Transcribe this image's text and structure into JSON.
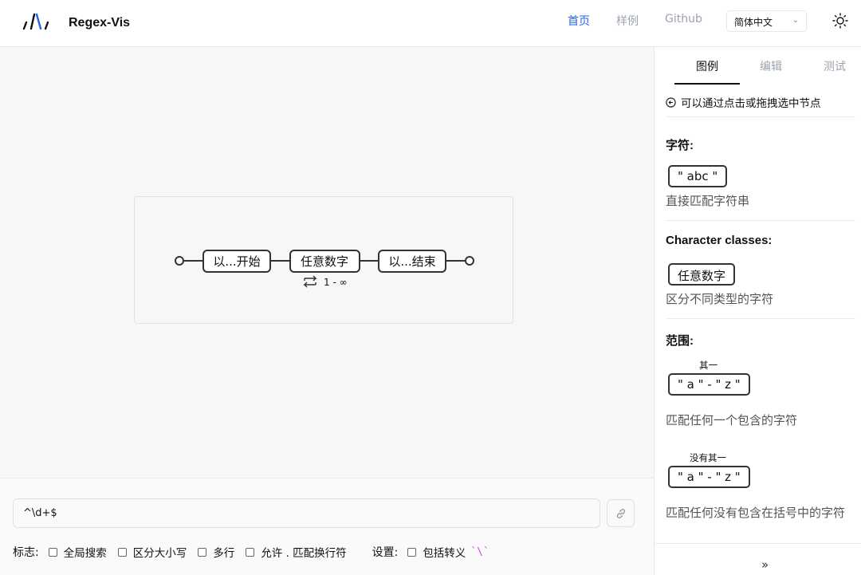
{
  "header": {
    "brand": "Regex-Vis",
    "nav": [
      "首页",
      "样例",
      "Github"
    ],
    "language": "简体中文"
  },
  "graph": {
    "nodes": [
      "以...开始",
      "任意数字",
      "以...结束"
    ],
    "quantifier": "1 - ∞"
  },
  "input": {
    "value": "^\\d+$"
  },
  "flags": {
    "label": "标志:",
    "items": [
      "全局搜索",
      "区分大小写",
      "多行",
      "允许 . 匹配换行符"
    ],
    "settings_label": "设置:",
    "settings_item": "包括转义",
    "escape_code": "`\\`"
  },
  "sidebar": {
    "tabs": [
      "图例",
      "编辑",
      "测试"
    ],
    "hint": "可以通过点击或拖拽选中节点",
    "sections": {
      "chars": {
        "title": "字符:",
        "sample": "\" abc \"",
        "desc": "直接匹配字符串"
      },
      "classes": {
        "title": "Character classes:",
        "sample": "任意数字",
        "desc": "区分不同类型的字符"
      },
      "ranges": {
        "title": "范围:",
        "label1": "其一",
        "sample1": "\" a \" - \" z \"",
        "desc1": "匹配任何一个包含的字符",
        "label2": "没有其一",
        "sample2": "\" a \" - \" z \"",
        "desc2": "匹配任何没有包含在括号中的字符"
      }
    },
    "expand": "»"
  },
  "colors": {
    "accent": "#2563eb",
    "escape": "#d946ef"
  }
}
